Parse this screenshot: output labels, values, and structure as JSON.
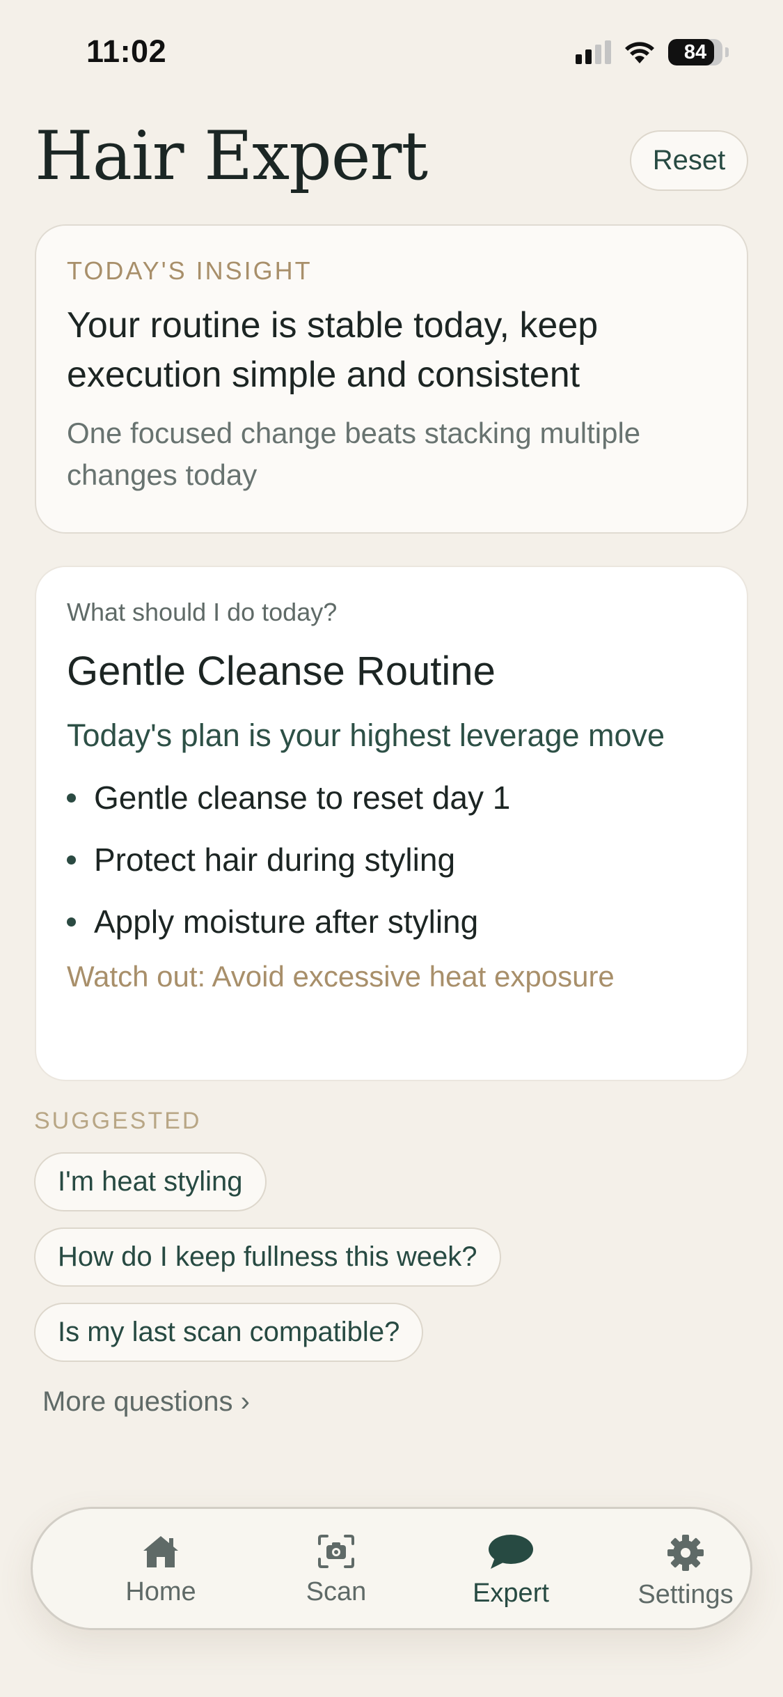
{
  "status_bar": {
    "time": "11:02",
    "battery_percent": 84,
    "battery_label": "84",
    "signal_bars_active": 2,
    "signal_bars_total": 4,
    "wifi": true
  },
  "header": {
    "title": "Hair Expert",
    "reset_label": "Reset"
  },
  "insight": {
    "label": "TODAY'S INSIGHT",
    "headline": "Your routine is stable today, keep execution simple and consistent",
    "subtext": "One focused change beats stacking multiple changes today"
  },
  "plan": {
    "question": "What should I do today?",
    "title": "Gentle Cleanse Routine",
    "lead": "Today's plan is your highest leverage move",
    "steps": [
      "Gentle cleanse to reset day 1",
      "Protect hair during styling",
      "Apply moisture after styling"
    ],
    "warning": "Watch out: Avoid excessive heat exposure"
  },
  "suggestions": {
    "label": "SUGGESTED",
    "chips": [
      "I'm heat styling",
      "How do I keep fullness this week?",
      "Is my last scan compatible?"
    ],
    "more_label": "More questions ›"
  },
  "tab_bar": {
    "active": "expert",
    "tabs": [
      {
        "key": "home",
        "label": "Home",
        "icon": "home-icon"
      },
      {
        "key": "scan",
        "label": "Scan",
        "icon": "camera-scan-icon"
      },
      {
        "key": "expert",
        "label": "Expert",
        "icon": "chat-bubble-icon"
      },
      {
        "key": "settings",
        "label": "Settings",
        "icon": "gear-icon"
      }
    ]
  },
  "colors": {
    "background": "#f4f0e9",
    "accent": "#274a42",
    "muted_gold": "#a88f6a",
    "card": "#ffffff"
  }
}
